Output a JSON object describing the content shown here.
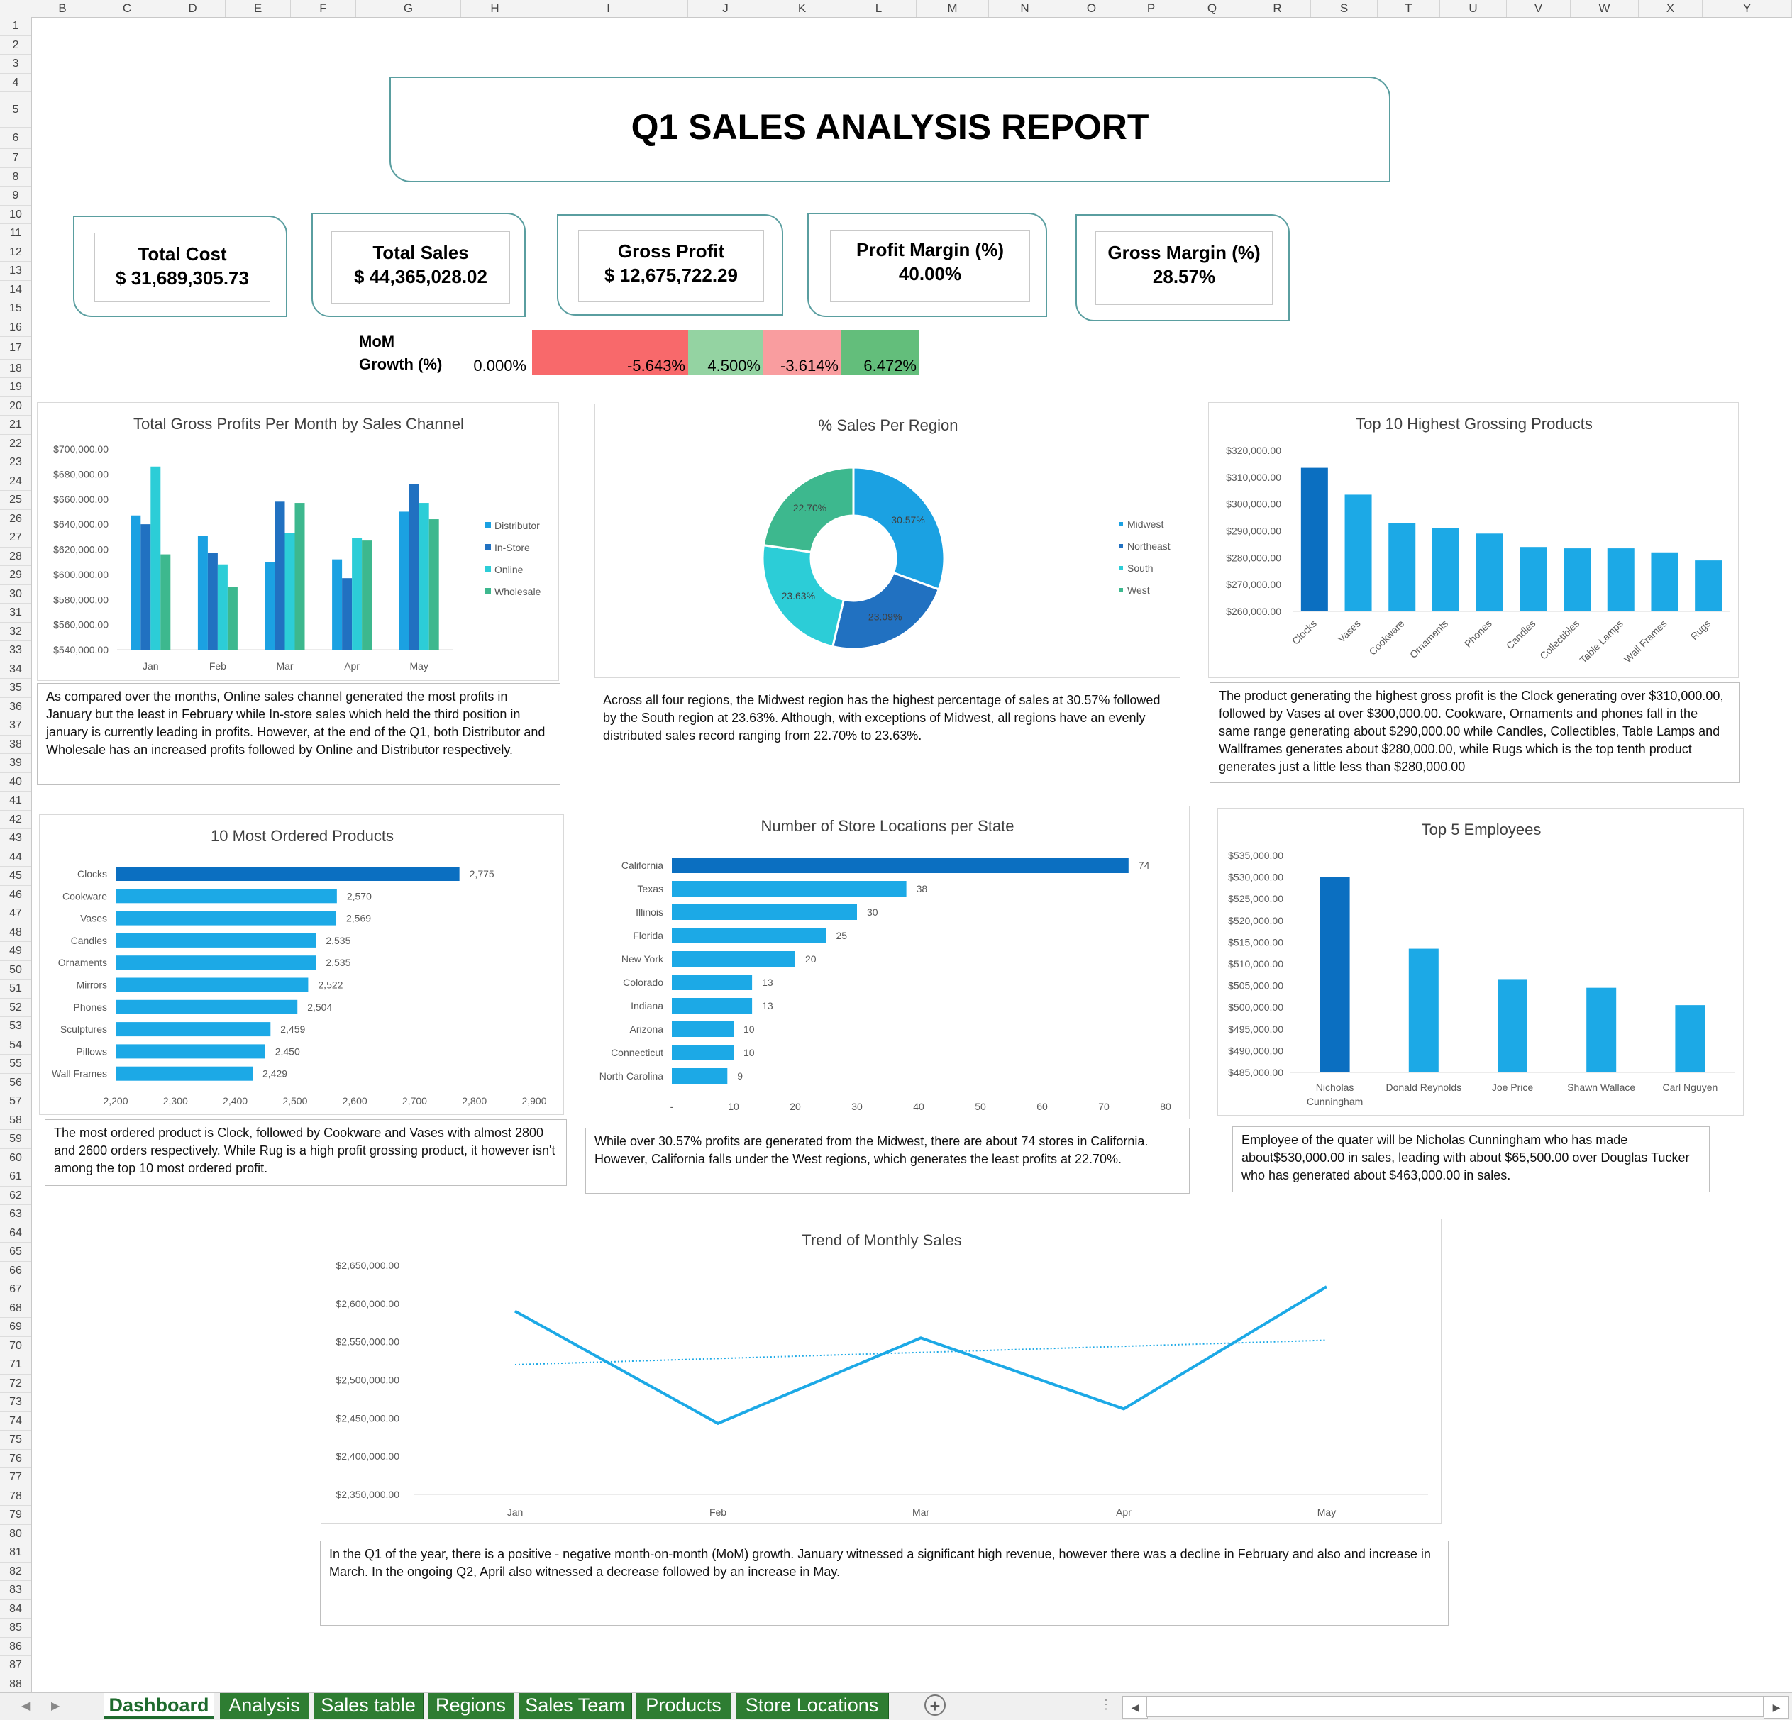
{
  "sheet": {
    "columns": [
      "B",
      "C",
      "D",
      "E",
      "F",
      "G",
      "H",
      "I",
      "J",
      "K",
      "L",
      "M",
      "N",
      "O",
      "P",
      "Q",
      "R",
      "S",
      "T",
      "U",
      "V",
      "W",
      "X",
      "Y"
    ],
    "rows": [
      "1",
      "2",
      "3",
      "4",
      "5",
      "6",
      "7",
      "8",
      "9",
      "10",
      "11",
      "12",
      "13",
      "14",
      "15",
      "16",
      "17",
      "18",
      "19",
      "20",
      "21",
      "22",
      "23",
      "24",
      "25",
      "26",
      "27",
      "28",
      "29",
      "30",
      "31",
      "32",
      "33",
      "34",
      "35",
      "36",
      "37",
      "38",
      "39",
      "40",
      "41",
      "42",
      "43",
      "44",
      "45",
      "46",
      "47",
      "48",
      "49",
      "50",
      "51",
      "52",
      "53",
      "54",
      "55",
      "56",
      "57",
      "58",
      "59",
      "60",
      "61",
      "62",
      "63",
      "64",
      "65",
      "66",
      "67",
      "68",
      "69",
      "70",
      "71",
      "72",
      "73",
      "74",
      "75",
      "76",
      "77",
      "78",
      "79",
      "80",
      "81",
      "82",
      "83",
      "84",
      "85",
      "86",
      "87",
      "88"
    ]
  },
  "report_title": "Q1 SALES ANALYSIS REPORT",
  "kpis": [
    {
      "label": "Total Cost",
      "value": "$ 31,689,305.73"
    },
    {
      "label": "Total Sales",
      "value": "$  44,365,028.02"
    },
    {
      "label": "Gross Profit",
      "value": "$ 12,675,722.29"
    },
    {
      "label": "Profit  Margin (%)",
      "value": "40.00%"
    },
    {
      "label": "Gross  Margin (%)",
      "value": "28.57%"
    }
  ],
  "mom": {
    "label_line1": "MoM",
    "label_line2": "Growth (%)",
    "values": [
      {
        "text": "0.000%",
        "color": "#ffffff"
      },
      {
        "text": "-5.643%",
        "color": "#f8696b"
      },
      {
        "text": "4.500%",
        "color": "#94d3a2"
      },
      {
        "text": "-3.614%",
        "color": "#f99d9f"
      },
      {
        "text": "6.472%",
        "color": "#63be7b"
      }
    ]
  },
  "colors": {
    "distributor": "#1ba1e2",
    "instore": "#2171c1",
    "online": "#2ccdd7",
    "wholesale": "#3db88e",
    "bar_main": "#1ca9e6",
    "bar_highlight": "#0b6fc1",
    "axis_text": "#595959",
    "title_text": "#404040"
  },
  "chart_data": [
    {
      "type": "bar",
      "title": "Total Gross Profits Per Month by Sales Channel",
      "categories": [
        "Jan",
        "Feb",
        "Mar",
        "Apr",
        "May"
      ],
      "series": [
        {
          "name": "Distributor",
          "values": [
            647000,
            631000,
            610000,
            612000,
            650000
          ]
        },
        {
          "name": "In-Store",
          "values": [
            640000,
            617000,
            658000,
            597000,
            672000
          ]
        },
        {
          "name": "Online",
          "values": [
            686000,
            608000,
            633000,
            629000,
            657000
          ]
        },
        {
          "name": "Wholesale",
          "values": [
            616000,
            590000,
            657000,
            627000,
            644000
          ]
        }
      ],
      "yticks": [
        "$540,000.00",
        "$560,000.00",
        "$580,000.00",
        "$600,000.00",
        "$620,000.00",
        "$640,000.00",
        "$660,000.00",
        "$680,000.00",
        "$700,000.00"
      ],
      "ylim": [
        540000,
        700000
      ],
      "legend": "right"
    },
    {
      "type": "pie",
      "title": "% Sales Per Region",
      "labels": [
        "Midwest",
        "Northeast",
        "South",
        "West"
      ],
      "values": [
        30.57,
        23.09,
        23.63,
        22.7
      ],
      "value_labels": [
        "30.57%",
        "23.09%",
        "23.63%",
        "22.70%"
      ],
      "legend": "right"
    },
    {
      "type": "bar",
      "title": "Top 10 Highest Grossing Products",
      "categories": [
        "Clocks",
        "Vases",
        "Cookware",
        "Ornaments",
        "Phones",
        "Candles",
        "Collectibles",
        "Table Lamps",
        "Wall Frames",
        "Rugs"
      ],
      "values": [
        313500,
        303500,
        293000,
        291000,
        289000,
        284000,
        283500,
        283500,
        282000,
        279000
      ],
      "yticks": [
        "$260,000.00",
        "$270,000.00",
        "$280,000.00",
        "$290,000.00",
        "$300,000.00",
        "$310,000.00",
        "$320,000.00"
      ],
      "ylim": [
        260000,
        320000
      ]
    },
    {
      "type": "bar",
      "orientation": "horizontal",
      "title": "10 Most Ordered Products",
      "categories": [
        "Clocks",
        "Cookware",
        "Vases",
        "Candles",
        "Ornaments",
        "Mirrors",
        "Phones",
        "Sculptures",
        "Pillows",
        "Wall Frames"
      ],
      "values": [
        2775,
        2570,
        2569,
        2535,
        2535,
        2522,
        2504,
        2459,
        2450,
        2429
      ],
      "value_labels": [
        "2,775",
        "2,570",
        "2,569",
        "2,535",
        "2,535",
        "2,522",
        "2,504",
        "2,459",
        "2,450",
        "2,429"
      ],
      "xticks": [
        "2,200",
        "2,300",
        "2,400",
        "2,500",
        "2,600",
        "2,700",
        "2,800",
        "2,900"
      ],
      "xlim": [
        2200,
        2900
      ]
    },
    {
      "type": "bar",
      "orientation": "horizontal",
      "title": "Number of Store Locations per State",
      "categories": [
        "California",
        "Texas",
        "Illinois",
        "Florida",
        "New York",
        "Colorado",
        "Indiana",
        "Arizona",
        "Connecticut",
        "North Carolina"
      ],
      "values": [
        74,
        38,
        30,
        25,
        20,
        13,
        13,
        10,
        10,
        9
      ],
      "value_labels": [
        "74",
        "38",
        "30",
        "25",
        "20",
        "13",
        "13",
        "10",
        "10",
        "9"
      ],
      "xticks": [
        "-",
        "10",
        "20",
        "30",
        "40",
        "50",
        "60",
        "70",
        "80"
      ],
      "xlim": [
        0,
        80
      ]
    },
    {
      "type": "bar",
      "title": "Top 5 Employees",
      "categories": [
        "Nicholas Cunningham",
        "Donald Reynolds",
        "Joe Price",
        "Shawn Wallace",
        "Carl Nguyen"
      ],
      "values": [
        530000,
        513500,
        506500,
        504500,
        500500
      ],
      "yticks": [
        "$485,000.00",
        "$490,000.00",
        "$495,000.00",
        "$500,000.00",
        "$505,000.00",
        "$510,000.00",
        "$515,000.00",
        "$520,000.00",
        "$525,000.00",
        "$530,000.00",
        "$535,000.00"
      ],
      "ylim": [
        485000,
        535000
      ]
    },
    {
      "type": "line",
      "title": "Trend of Monthly Sales",
      "categories": [
        "Jan",
        "Feb",
        "Mar",
        "Apr",
        "May"
      ],
      "values": [
        2590000,
        2443000,
        2555000,
        2462000,
        2622000
      ],
      "trendline": [
        2520000,
        2528000,
        2536000,
        2544000,
        2552000
      ],
      "yticks": [
        "$2,350,000.00",
        "$2,400,000.00",
        "$2,450,000.00",
        "$2,500,000.00",
        "$2,550,000.00",
        "$2,600,000.00",
        "$2,650,000.00"
      ],
      "ylim": [
        2350000,
        2650000
      ]
    }
  ],
  "notes": {
    "channel": "As compared over the months, Online sales channel generated the most profits in January but the least in February while In-store sales which held the third position in january is currently leading in profits. However, at the end of the Q1, both Distributor and Wholesale has an increased profits followed by Online and Distributor respectively.",
    "region": "Across all four regions, the Midwest region has the highest percentage of sales at 30.57% followed by the South region at 23.63%. Although, with exceptions of Midwest, all regions have an evenly distributed sales record ranging from 22.70% to 23.63%.",
    "products": "The product generating the highest gross profit is the Clock generating over $310,000.00, followed by Vases at over $300,000.00. Cookware, Ornaments and phones fall in the same range generating about $290,000.00 while  Candles, Collectibles, Table Lamps and Wallframes generates about $280,000.00, while Rugs which is the top tenth product generates just a little less than $280,000.00",
    "ordered": "The most ordered product is Clock, followed by Cookware and Vases with almost 2800 and 2600 orders respectively. While Rug is a high profit grossing product, it however isn't among the top 10 most ordered profit.",
    "stores": "While over 30.57% profits are generated from the Midwest, there are about 74 stores in California. However, California falls under the West regions, which generates the least profits at 22.70%.",
    "employees": "Employee of the quater will be Nicholas Cunningham who has made about$530,000.00 in sales, leading with about $65,500.00 over Douglas Tucker who has generated about $463,000.00 in sales.",
    "trend": "In the Q1 of the year, there is a positive - negative month-on-month (MoM) growth. January witnessed a significant high revenue, however there was a decline in February and also and increase in March. In the ongoing Q2, April also witnessed a decrease followed by an increase in May."
  },
  "tabs": [
    "Dashboard",
    "Analysis",
    "Sales table",
    "Regions",
    "Sales Team",
    "Products",
    "Store Locations"
  ],
  "icons": {
    "add_sheet": "plus-circle-icon",
    "scroll_left": "triangle-left-icon",
    "scroll_right": "triangle-right-icon"
  }
}
